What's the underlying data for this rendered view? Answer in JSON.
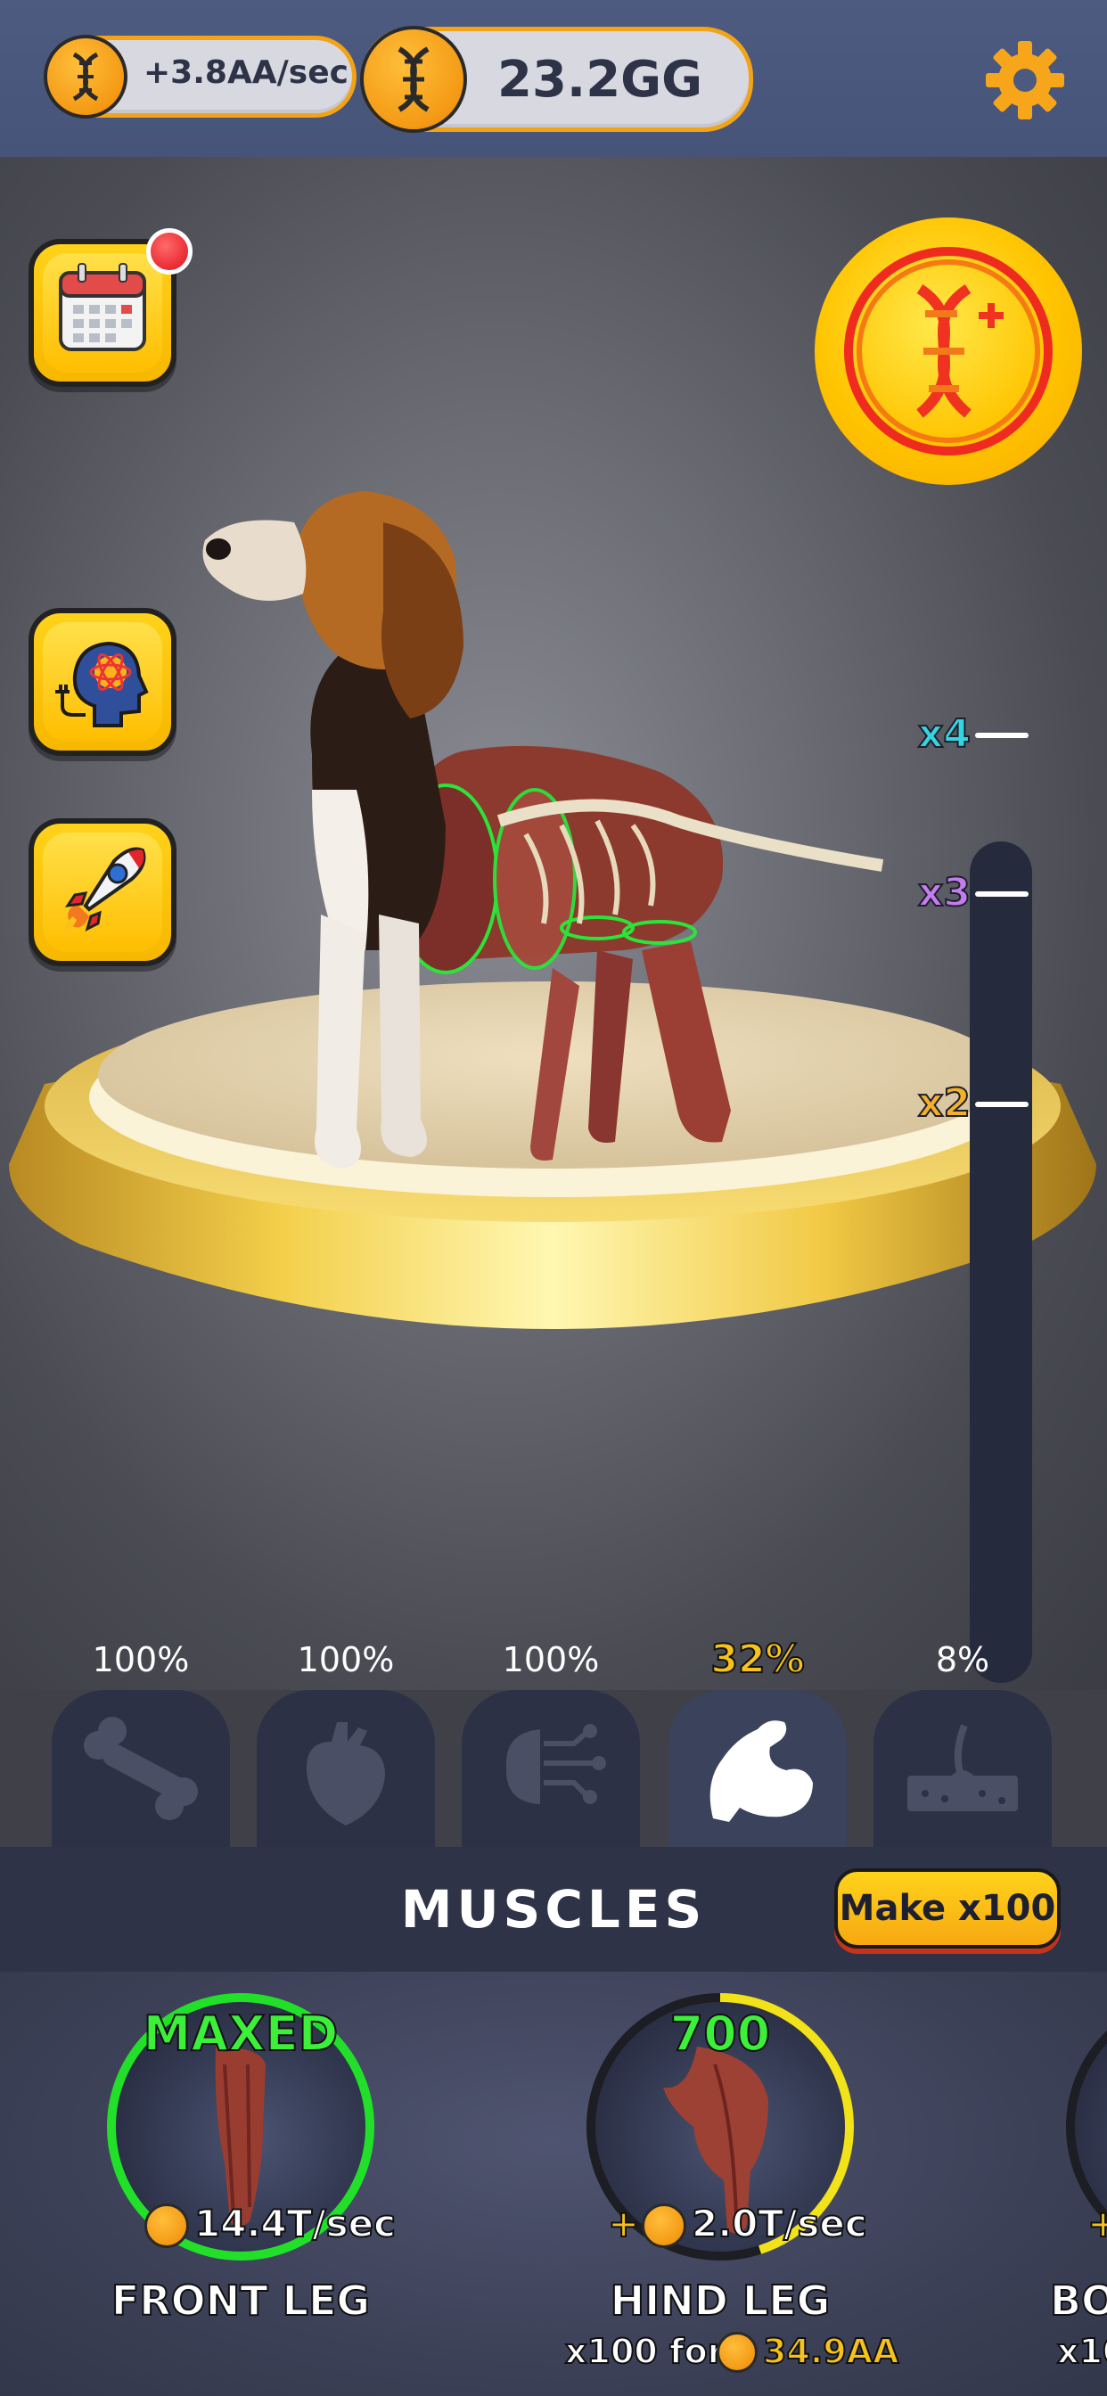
{
  "header": {
    "rate": "+3.8AA/sec",
    "balance": "23.2GG"
  },
  "multipliers": [
    {
      "label": "x4",
      "color": "#35d4e0"
    },
    {
      "label": "x3",
      "color": "#c67cf0"
    },
    {
      "label": "x2",
      "color": "#f4b02a"
    }
  ],
  "tabs": [
    {
      "percent": "100%",
      "icon": "bone-icon",
      "active": false
    },
    {
      "percent": "100%",
      "icon": "heart-icon",
      "active": false
    },
    {
      "percent": "100%",
      "icon": "brain-icon",
      "active": false
    },
    {
      "percent": "32%",
      "icon": "muscle-icon",
      "active": true
    },
    {
      "percent": "8%",
      "icon": "skin-icon",
      "active": false
    }
  ],
  "section": {
    "title": "MUSCLES",
    "make_label": "Make x100"
  },
  "upgrades": [
    {
      "status": "MAXED",
      "income": "14.4T/sec",
      "name": "FRONT LEG",
      "progress": 1.0
    },
    {
      "status": "700",
      "income_prefix": "+",
      "income": "2.0T/sec",
      "name": "HIND LEG",
      "cost_prefix": "x100 for",
      "cost": "34.9AA",
      "progress": 0.45
    },
    {
      "income_prefix": "+",
      "name": "BO",
      "cost_prefix": "x10"
    }
  ],
  "colors": {
    "accent": "#f7b700",
    "maxed_ring": "#22e02a",
    "progress_ring": "#f2e21a",
    "cost_text": "#f6c21a"
  }
}
